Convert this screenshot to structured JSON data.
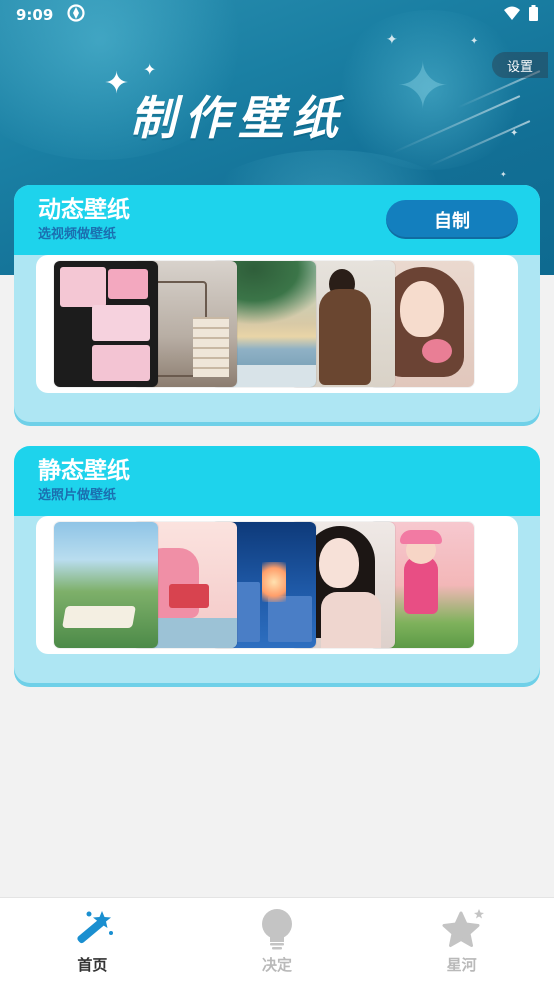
{
  "status_bar": {
    "time": "9:09"
  },
  "header": {
    "title": "制作壁纸",
    "settings_label": "设置"
  },
  "cards": [
    {
      "title": "动态壁纸",
      "subtitle": "选视频做壁纸",
      "action_label": "自制"
    },
    {
      "title": "静态壁纸",
      "subtitle": "选照片做壁纸"
    }
  ],
  "bottom_nav": {
    "items": [
      {
        "label": "首页",
        "icon": "magic-wand-icon",
        "active": true
      },
      {
        "label": "决定",
        "icon": "lightbulb-icon",
        "active": false
      },
      {
        "label": "星河",
        "icon": "star-icon",
        "active": false
      }
    ]
  },
  "colors": {
    "banner": "#1a7fa3",
    "card_head": "#1ed3ec",
    "card_body": "#aee6f3",
    "button": "#137fbe",
    "nav_active": "#1a8fd0",
    "nav_inactive": "#c4c4c4"
  }
}
